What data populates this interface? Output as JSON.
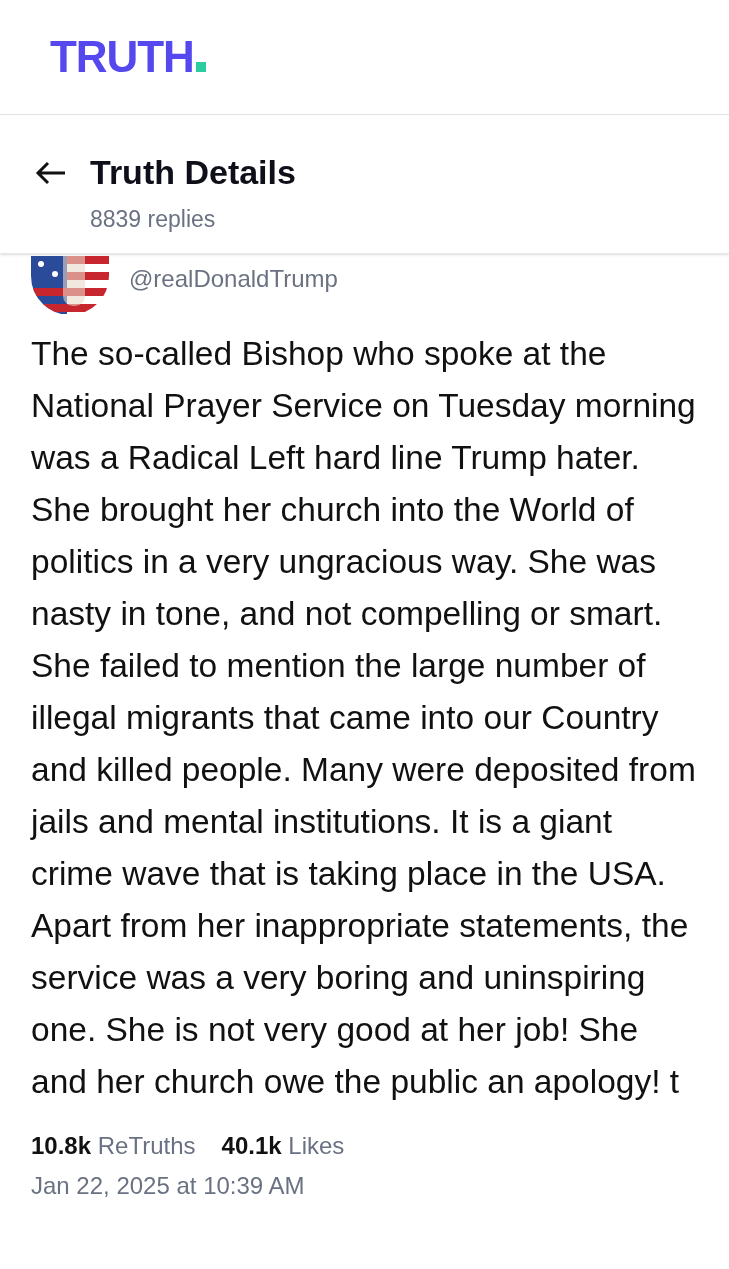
{
  "logo": {
    "text": "TRUTH"
  },
  "header": {
    "title": "Truth Details",
    "subtitle": "8839 replies"
  },
  "post": {
    "handle": "@realDonaldTrump",
    "text": "The so-called Bishop who spoke at the National Prayer Service on Tuesday morning was a Radical Left hard line Trump hater. She brought her church into the World of politics in a very ungracious way. She was nasty in tone, and not compelling or smart. She failed to mention the large number of illegal migrants that came into our Country and killed people. Many were deposited from jails and mental institutions. It is a giant crime wave that is taking place in the USA. Apart from her inappropriate statements, the service was a very boring and uninspiring one. She is not very good at her job! She and her church owe the public an apology! t",
    "stats": [
      "**10.8k** ReTruths",
      "**40.1k** Likes"
    ],
    "timestamp": "Jan 22, 2025 at 10:39 AM"
  }
}
